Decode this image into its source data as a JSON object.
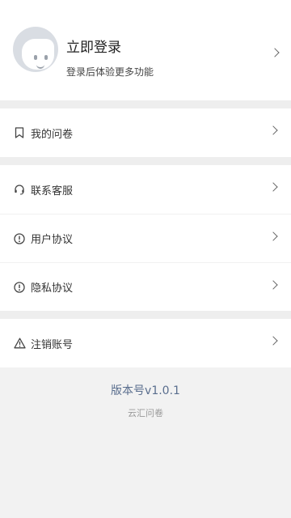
{
  "profile": {
    "title": "立即登录",
    "subtitle": "登录后体验更多功能"
  },
  "menu": {
    "groups": [
      [
        {
          "label": "我的问卷",
          "icon": "bookmark-icon"
        }
      ],
      [
        {
          "label": "联系客服",
          "icon": "headset-icon"
        },
        {
          "label": "用户协议",
          "icon": "info-circle-icon"
        },
        {
          "label": "隐私协议",
          "icon": "info-circle-icon"
        }
      ],
      [
        {
          "label": "注销账号",
          "icon": "warning-triangle-icon"
        }
      ]
    ]
  },
  "footer": {
    "version": "版本号v1.0.1",
    "brand": "云汇问卷"
  },
  "colors": {
    "background": "#f2f2f2",
    "version_text": "#5a6e8e",
    "avatar_bg": "#d9dde3"
  }
}
